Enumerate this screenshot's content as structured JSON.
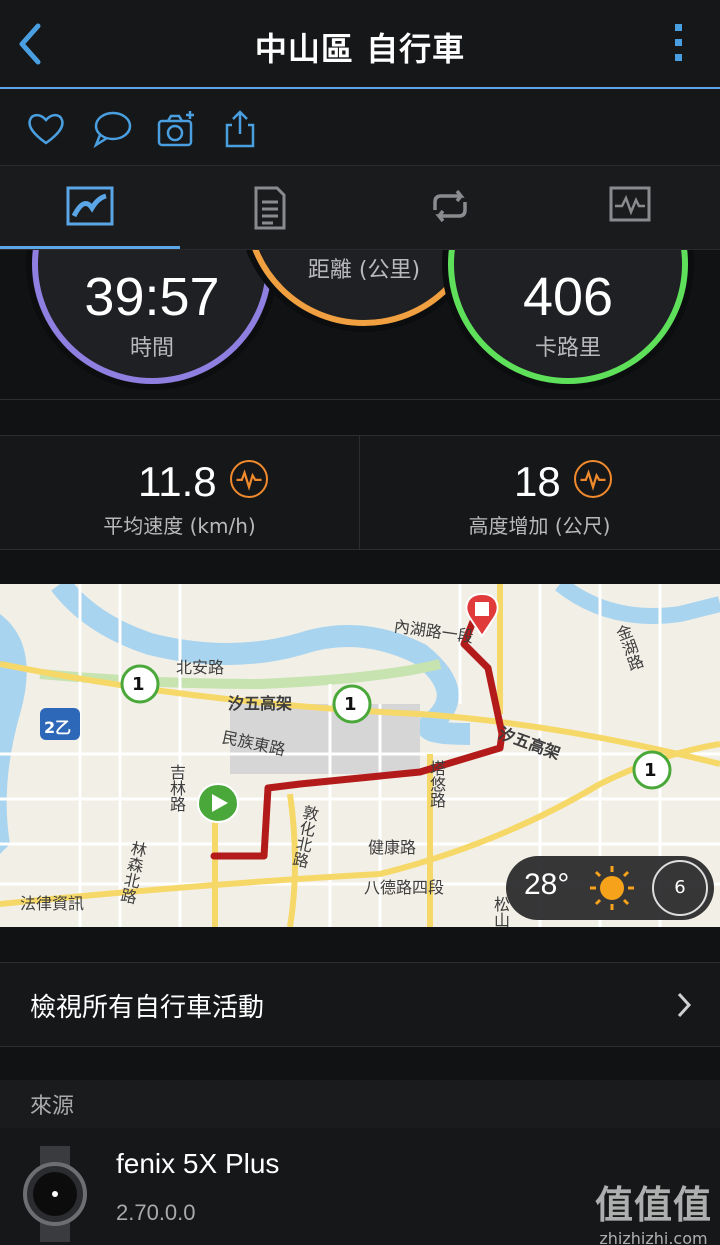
{
  "header": {
    "title": "中山區 自行車"
  },
  "circles": {
    "time": {
      "value": "39:57",
      "label": "時間"
    },
    "distance": {
      "label": "距離 (公里)"
    },
    "calories": {
      "value": "406",
      "label": "卡路里"
    }
  },
  "stats": [
    {
      "value": "11.8",
      "label": "平均速度 (km/h)"
    },
    {
      "value": "18",
      "label": "高度增加 (公尺)"
    }
  ],
  "map": {
    "labels": [
      "北安路",
      "汐五高架",
      "民族東路",
      "吉林路",
      "林森北路",
      "法律資訊",
      "敦化北路",
      "健康路",
      "八德路四段",
      "塔悠路",
      "汐五高架",
      "內湖路一段",
      "金湖路",
      "松山"
    ],
    "temperature": "28°",
    "compass": "6",
    "badge_1": "1",
    "badge_2": "2乙"
  },
  "view_all": {
    "label": "檢視所有自行車活動"
  },
  "source": {
    "section_label": "來源",
    "device_name": "fenix 5X Plus",
    "device_version": "2.70.0.0"
  },
  "watermark": {
    "main": "值值值",
    "sub": "zhizhizhi.com"
  },
  "colors": {
    "accent": "#5aa6e6",
    "time_ring": "#8f7fe0",
    "distance_ring": "#f0a040",
    "calories_ring": "#5ee05a",
    "heart_icon": "#f08a2c",
    "route": "#b31b1b"
  }
}
